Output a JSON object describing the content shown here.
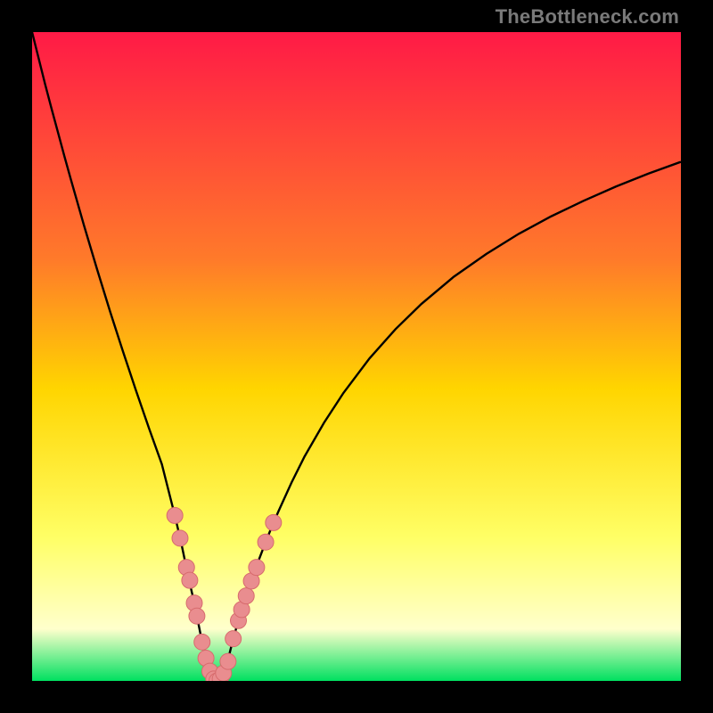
{
  "watermark": "TheBottleneck.com",
  "colors": {
    "frame": "#000000",
    "gradient_top": "#ff1a46",
    "gradient_mid_upper": "#ff7a2a",
    "gradient_mid": "#ffd500",
    "gradient_lower": "#ffff66",
    "gradient_pale": "#ffffcc",
    "gradient_bottom": "#00e060",
    "curve": "#000000",
    "dot_fill": "#e98d8f",
    "dot_stroke": "#d76b6d"
  },
  "chart_data": {
    "type": "line",
    "title": "",
    "xlabel": "",
    "ylabel": "",
    "xlim": [
      0,
      100
    ],
    "ylim": [
      0,
      100
    ],
    "x": [
      0,
      1,
      2,
      3,
      4,
      5,
      6,
      8,
      10,
      12,
      14,
      16,
      18,
      20,
      22,
      23,
      24,
      25,
      26,
      27,
      28,
      28.5,
      29,
      30,
      31,
      32,
      33,
      34,
      35,
      36,
      37,
      38,
      40,
      42,
      45,
      48,
      52,
      56,
      60,
      65,
      70,
      75,
      80,
      85,
      90,
      95,
      100
    ],
    "values": [
      100,
      96,
      92,
      88.2,
      84.5,
      80.8,
      77.2,
      70.2,
      63.5,
      57,
      50.8,
      44.8,
      39,
      33.4,
      25.5,
      21.2,
      16.4,
      12,
      7,
      2.4,
      0.3,
      0,
      0.3,
      2.5,
      6.5,
      10,
      13.1,
      16,
      18.8,
      21.4,
      23.9,
      26.2,
      30.6,
      34.6,
      39.8,
      44.4,
      49.7,
      54.2,
      58.1,
      62.3,
      65.8,
      68.9,
      71.6,
      74,
      76.2,
      78.2,
      80
    ],
    "dots": [
      {
        "x": 22.0,
        "y": 25.5
      },
      {
        "x": 22.8,
        "y": 22.0
      },
      {
        "x": 23.8,
        "y": 17.5
      },
      {
        "x": 24.3,
        "y": 15.5
      },
      {
        "x": 25.0,
        "y": 12.0
      },
      {
        "x": 25.4,
        "y": 10.0
      },
      {
        "x": 26.2,
        "y": 6.0
      },
      {
        "x": 26.8,
        "y": 3.5
      },
      {
        "x": 27.4,
        "y": 1.5
      },
      {
        "x": 28.0,
        "y": 0.3
      },
      {
        "x": 28.5,
        "y": 0.0
      },
      {
        "x": 29.0,
        "y": 0.3
      },
      {
        "x": 29.5,
        "y": 1.2
      },
      {
        "x": 30.2,
        "y": 3.0
      },
      {
        "x": 31.0,
        "y": 6.5
      },
      {
        "x": 31.8,
        "y": 9.3
      },
      {
        "x": 32.3,
        "y": 11.0
      },
      {
        "x": 33.0,
        "y": 13.1
      },
      {
        "x": 33.8,
        "y": 15.4
      },
      {
        "x": 34.6,
        "y": 17.5
      },
      {
        "x": 36.0,
        "y": 21.4
      },
      {
        "x": 37.2,
        "y": 24.4
      }
    ]
  }
}
